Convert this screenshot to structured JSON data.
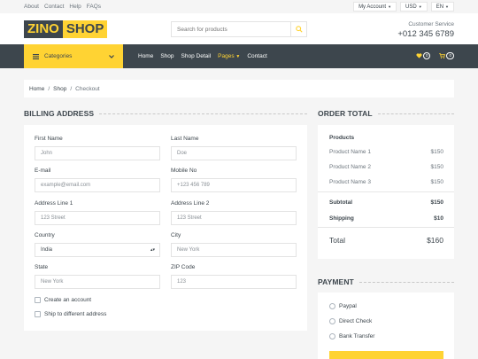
{
  "topbar": {
    "links": [
      "About",
      "Contact",
      "Help",
      "FAQs"
    ],
    "account": "My Account",
    "currency": "USD",
    "language": "EN"
  },
  "header": {
    "logo_left": "ZINO",
    "logo_right": "SHOP",
    "search_placeholder": "Search for products",
    "service_label": "Customer Service",
    "phone": "+012 345 6789"
  },
  "nav": {
    "categories_label": "Categories",
    "links": [
      "Home",
      "Shop",
      "Shop Detail",
      "Pages",
      "Contact"
    ],
    "active_link": "Pages",
    "wishlist_count": "0",
    "cart_count": "0"
  },
  "breadcrumb": [
    "Home",
    "Shop",
    "Checkout"
  ],
  "billing": {
    "title": "BILLING ADDRESS",
    "fields": {
      "first_name": {
        "label": "First Name",
        "placeholder": "John"
      },
      "last_name": {
        "label": "Last Name",
        "placeholder": "Doe"
      },
      "email": {
        "label": "E-mail",
        "placeholder": "example@email.com"
      },
      "mobile": {
        "label": "Mobile No",
        "placeholder": "+123 456 789"
      },
      "address1": {
        "label": "Address Line 1",
        "placeholder": "123 Street"
      },
      "address2": {
        "label": "Address Line 2",
        "placeholder": "123 Street"
      },
      "country": {
        "label": "Country",
        "value": "India"
      },
      "city": {
        "label": "City",
        "placeholder": "New York"
      },
      "state": {
        "label": "State",
        "placeholder": "New York"
      },
      "zip": {
        "label": "ZIP Code",
        "placeholder": "123"
      }
    },
    "create_account": "Create an account",
    "ship_different": "Ship to different address"
  },
  "order": {
    "title": "ORDER TOTAL",
    "products_label": "Products",
    "products": [
      {
        "name": "Product Name 1",
        "price": "$150"
      },
      {
        "name": "Product Name 2",
        "price": "$150"
      },
      {
        "name": "Product Name 3",
        "price": "$150"
      }
    ],
    "subtotal_label": "Subtotal",
    "subtotal": "$150",
    "shipping_label": "Shipping",
    "shipping": "$10",
    "total_label": "Total",
    "total": "$160"
  },
  "payment": {
    "title": "PAYMENT",
    "options": [
      "Paypal",
      "Direct Check",
      "Bank Transfer"
    ]
  },
  "colors": {
    "accent": "#ffd333",
    "dark": "#3d464d",
    "background": "#f5f5f5"
  }
}
